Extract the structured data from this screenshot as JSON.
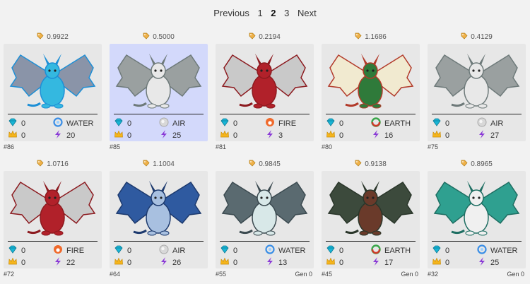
{
  "pagination": {
    "previous": "Previous",
    "pages": [
      "1",
      "2",
      "3"
    ],
    "current": "2",
    "next": "Next"
  },
  "colors": {
    "selected_card": "#d3d9fb",
    "card": "#e7e7e7",
    "WATER": "#3a8ee6",
    "AIR": "#c0c0c0",
    "FIRE": "#f06a2c",
    "EARTH": "#3aa64a"
  },
  "dragons": [
    {
      "price": "0.9922",
      "id": "#86",
      "gems": "0",
      "crowns": "0",
      "element": "WATER",
      "power": "20",
      "gen": "",
      "selected": false,
      "icon": "dragon-water-blue-icon"
    },
    {
      "price": "0.5000",
      "id": "#85",
      "gems": "0",
      "crowns": "0",
      "element": "AIR",
      "power": "25",
      "gen": "",
      "selected": true,
      "icon": "dragon-air-white-icon"
    },
    {
      "price": "0.2194",
      "id": "#81",
      "gems": "0",
      "crowns": "0",
      "element": "FIRE",
      "power": "3",
      "gen": "",
      "selected": false,
      "icon": "dragon-fire-red-icon"
    },
    {
      "price": "1.1686",
      "id": "#80",
      "gems": "0",
      "crowns": "0",
      "element": "EARTH",
      "power": "16",
      "gen": "",
      "selected": false,
      "icon": "dragon-earth-green-icon"
    },
    {
      "price": "0.4129",
      "id": "#75",
      "gems": "0",
      "crowns": "0",
      "element": "AIR",
      "power": "27",
      "gen": "",
      "selected": false,
      "icon": "dragon-air-white-icon"
    },
    {
      "price": "1.0716",
      "id": "#72",
      "gems": "0",
      "crowns": "0",
      "element": "FIRE",
      "power": "22",
      "gen": "",
      "selected": false,
      "icon": "dragon-fire-red-icon"
    },
    {
      "price": "1.1004",
      "id": "#64",
      "gems": "0",
      "crowns": "0",
      "element": "AIR",
      "power": "26",
      "gen": "",
      "selected": false,
      "icon": "dragon-air-blue-icon"
    },
    {
      "price": "0.9845",
      "id": "#55",
      "gems": "0",
      "crowns": "0",
      "element": "WATER",
      "power": "13",
      "gen": "Gen 0",
      "selected": false,
      "icon": "dragon-water-dark-icon"
    },
    {
      "price": "0.9138",
      "id": "#45",
      "gems": "0",
      "crowns": "0",
      "element": "EARTH",
      "power": "17",
      "gen": "Gen 0",
      "selected": false,
      "icon": "dragon-earth-dark-icon"
    },
    {
      "price": "0.8965",
      "id": "#32",
      "gems": "0",
      "crowns": "0",
      "element": "WATER",
      "power": "25",
      "gen": "Gen 0",
      "selected": false,
      "icon": "dragon-water-teal-icon"
    }
  ]
}
